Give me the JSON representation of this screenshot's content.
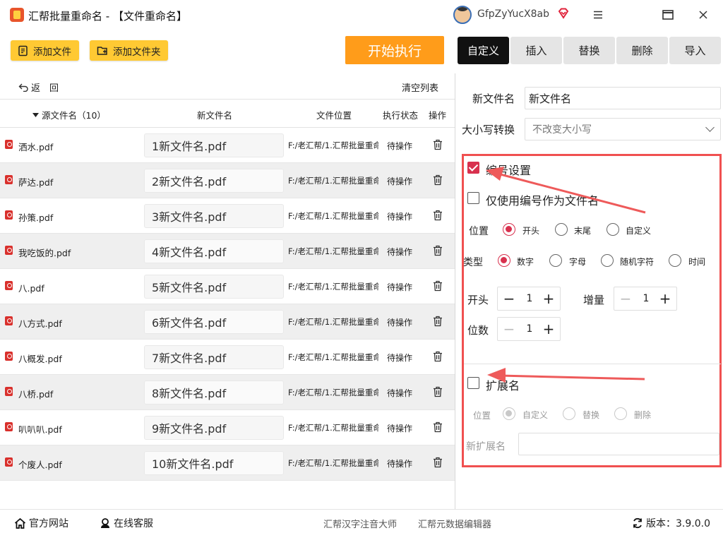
{
  "window": {
    "title": "汇帮批量重命名 - 【文件重命名】",
    "username": "GfpZyYucX8ab",
    "accent": "#d8314e"
  },
  "toolbar": {
    "add_files": "添加文件",
    "add_folder": "添加文件夹",
    "start": "开始执行"
  },
  "list": {
    "back_label": "返　回",
    "clear_label": "清空列表",
    "headers": {
      "source": "源文件名（10）",
      "new_name": "新文件名",
      "location": "文件位置",
      "status": "执行状态",
      "action": "操作"
    },
    "rows": [
      {
        "source": "洒水.pdf",
        "new": "1新文件名.pdf",
        "path": "F:/老汇帮/1.汇帮批量重命",
        "status": "待操作"
      },
      {
        "source": "萨达.pdf",
        "new": "2新文件名.pdf",
        "path": "F:/老汇帮/1.汇帮批量重命",
        "status": "待操作"
      },
      {
        "source": "孙策.pdf",
        "new": "3新文件名.pdf",
        "path": "F:/老汇帮/1.汇帮批量重命",
        "status": "待操作"
      },
      {
        "source": "我吃饭的.pdf",
        "new": "4新文件名.pdf",
        "path": "F:/老汇帮/1.汇帮批量重命",
        "status": "待操作"
      },
      {
        "source": "八.pdf",
        "new": "5新文件名.pdf",
        "path": "F:/老汇帮/1.汇帮批量重命",
        "status": "待操作"
      },
      {
        "source": "八方式.pdf",
        "new": "6新文件名.pdf",
        "path": "F:/老汇帮/1.汇帮批量重命",
        "status": "待操作"
      },
      {
        "source": "八概发.pdf",
        "new": "7新文件名.pdf",
        "path": "F:/老汇帮/1.汇帮批量重命",
        "status": "待操作"
      },
      {
        "source": "八桥.pdf",
        "new": "8新文件名.pdf",
        "path": "F:/老汇帮/1.汇帮批量重命",
        "status": "待操作"
      },
      {
        "source": "叭叭叭.pdf",
        "new": "9新文件名.pdf",
        "path": "F:/老汇帮/1.汇帮批量重命",
        "status": "待操作"
      },
      {
        "source": "个废人.pdf",
        "new": "10新文件名.pdf",
        "path": "F:/老汇帮/1.汇帮批量重命",
        "status": "待操作"
      }
    ]
  },
  "tabs": {
    "custom": "自定义",
    "insert": "插入",
    "replace": "替换",
    "delete": "删除",
    "import": "导入"
  },
  "settings": {
    "new_name_label": "新文件名",
    "new_name_value": "新文件名",
    "case_label": "大小写转换",
    "case_value": "不改变大小写",
    "numbering": {
      "title": "编号设置",
      "checked": true,
      "only_number_label": "仅使用编号作为文件名",
      "position_label": "位置",
      "position_options": [
        "开头",
        "末尾",
        "自定义"
      ],
      "type_label": "类型",
      "type_options": [
        "数字",
        "字母",
        "随机字符",
        "时间"
      ],
      "start_label": "开头",
      "start_value": "1",
      "increment_label": "增量",
      "increment_value": "1",
      "digits_label": "位数",
      "digits_value": "1"
    },
    "extension": {
      "title": "扩展名",
      "position_label": "位置",
      "position_options": [
        "自定义",
        "替换",
        "删除"
      ],
      "new_ext_label": "新扩展名"
    }
  },
  "bottom": {
    "website": "官方网站",
    "service": "在线客服",
    "link1": "汇帮汉字注音大师",
    "link2": "汇帮元数据编辑器",
    "version": "版本：3.9.0.0"
  }
}
